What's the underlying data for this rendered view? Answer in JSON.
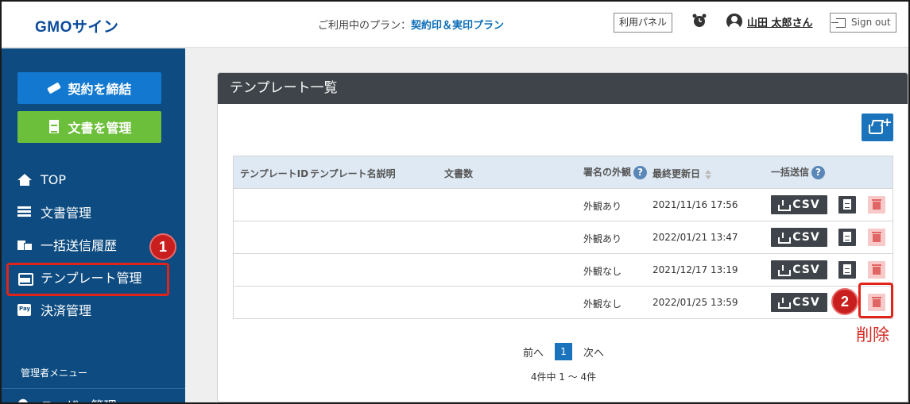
{
  "header": {
    "logo": "GMOサイン",
    "plan_label": "ご利用中のプラン：",
    "plan_name": "契約印＆実印プラン",
    "panel_button": "利用パネル",
    "user_name": "山田 太郎さん",
    "signout": "Sign out"
  },
  "sidebar": {
    "contract_button": "契約を締結",
    "docs_button": "文書を管理",
    "items": [
      {
        "label": "TOP",
        "icon": "home-icon"
      },
      {
        "label": "文書管理",
        "icon": "list-icon"
      },
      {
        "label": "一括送信履歴",
        "icon": "send-history-icon"
      },
      {
        "label": "テンプレート管理",
        "icon": "template-tray-icon"
      },
      {
        "label": "決済管理",
        "icon": "pay-icon"
      }
    ],
    "admin_menu": "管理者メニュー",
    "user_mgmt": "ユーザー管理"
  },
  "annotations": {
    "step1": "1",
    "step2": "2",
    "delete_caption": "削除",
    "highlight_color": "#e2231a"
  },
  "panel": {
    "title": "テンプレート一覧",
    "columns": {
      "template_id": "テンプレートID",
      "template_name": "テンプレート名",
      "description": "説明",
      "doc_count": "文書数",
      "appearance": "署名の外観",
      "updated": "最終更新日",
      "bulk_send": "一括送信"
    },
    "help_mark": "?",
    "rows": [
      {
        "appearance": "外観あり",
        "updated": "2021/11/16 17:56",
        "csv": "CSV"
      },
      {
        "appearance": "外観あり",
        "updated": "2022/01/21 13:47",
        "csv": "CSV"
      },
      {
        "appearance": "外観なし",
        "updated": "2021/12/17 13:19",
        "csv": "CSV"
      },
      {
        "appearance": "外観なし",
        "updated": "2022/01/25 13:59",
        "csv": "CSV"
      }
    ],
    "pager": {
      "prev": "前へ",
      "current": "1",
      "next": "次へ"
    },
    "count_text": "4件中 1 ～ 4件"
  },
  "colors": {
    "sidebar": "#0d4b80",
    "contract_button": "#1379d0",
    "docs_button": "#6cbf3a",
    "panel_header": "#3e4449",
    "accent": "#1b74bb"
  }
}
